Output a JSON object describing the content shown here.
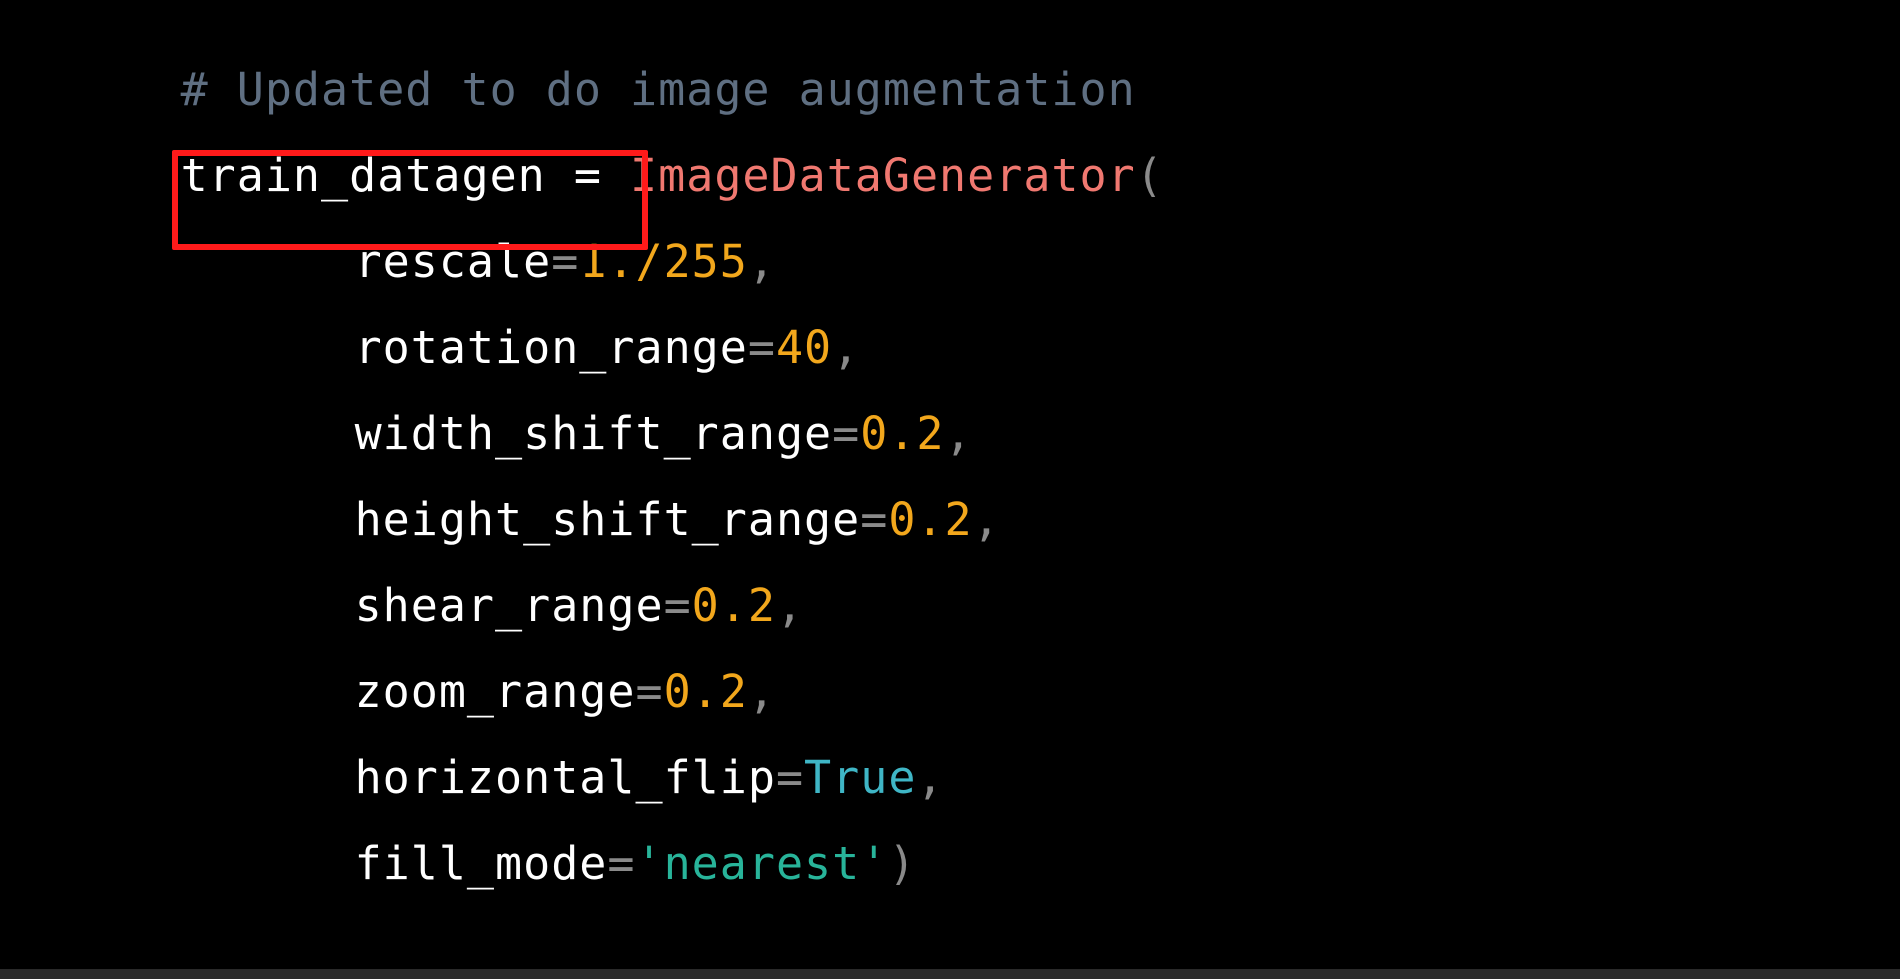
{
  "code": {
    "comment": "# Updated to do image augmentation",
    "assign_var": "train_datagen",
    "assign_op": " = ",
    "class_name": "ImageDataGenerator",
    "open_paren": "(",
    "args": [
      {
        "name": "rescale",
        "eq": "=",
        "value": "1./255",
        "sep": ","
      },
      {
        "name": "rotation_range",
        "eq": "=",
        "value": "40",
        "sep": ","
      },
      {
        "name": "width_shift_range",
        "eq": "=",
        "value": "0.2",
        "sep": ","
      },
      {
        "name": "height_shift_range",
        "eq": "=",
        "value": "0.2",
        "sep": ","
      },
      {
        "name": "shear_range",
        "eq": "=",
        "value": "0.2",
        "sep": ","
      },
      {
        "name": "zoom_range",
        "eq": "=",
        "value": "0.2",
        "sep": ","
      },
      {
        "name": "horizontal_flip",
        "eq": "=",
        "value": "True",
        "sep": ","
      },
      {
        "name": "fill_mode",
        "eq": "=",
        "value": "'nearest'",
        "sep": ")"
      }
    ]
  },
  "colors": {
    "background": "#000000",
    "comment": "#5f6f82",
    "class_name": "#f07870",
    "number": "#f2a71c",
    "keyword": "#3fb6c6",
    "string": "#28b49a",
    "highlight_border": "#ff1a1a"
  }
}
